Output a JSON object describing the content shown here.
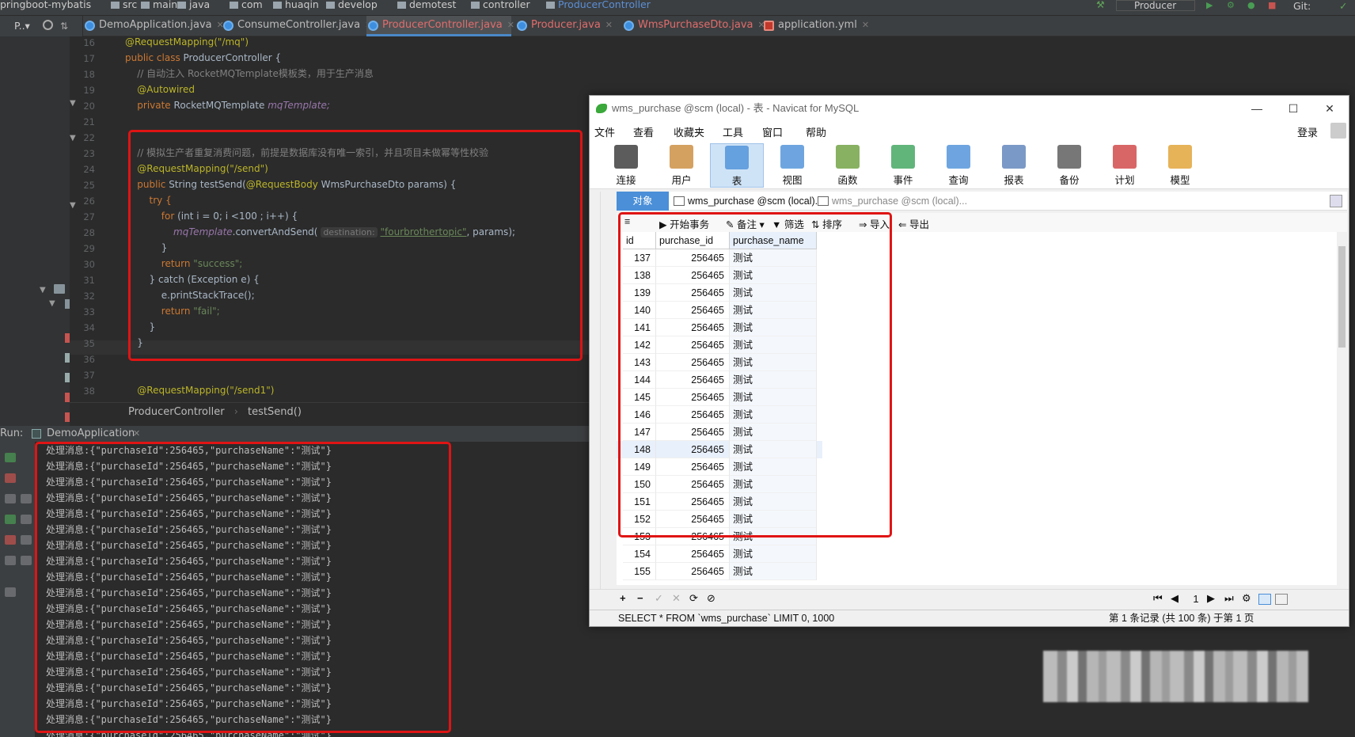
{
  "ide": {
    "breadcrumbs": [
      "pringboot-mybatis",
      "src",
      "main",
      "java",
      "com",
      "huaqin",
      "develop",
      "demotest",
      "controller",
      "ProducerController"
    ],
    "run_config": "Producer",
    "vcs": "Git:",
    "project_label": "P..▾",
    "tabs": [
      {
        "label": "DemoApplication.java"
      },
      {
        "label": "ConsumeController.java"
      },
      {
        "label": "ProducerController.java"
      },
      {
        "label": "Producer.java"
      },
      {
        "label": "WmsPurchaseDto.java"
      },
      {
        "label": "application.yml"
      }
    ],
    "line_numbers": [
      "16",
      "17",
      "18",
      "19",
      "20",
      "21",
      "22",
      "23",
      "24",
      "25",
      "26",
      "27",
      "28",
      "29",
      "30",
      "31",
      "32",
      "33",
      "34",
      "35",
      "36",
      "37",
      "38"
    ],
    "code": {
      "l16": "@RequestMapping(\"/mq\")",
      "l17_kw": "public class ",
      "l17_name": "ProducerController {",
      "l18": "// 自动注入 RocketMQTemplate模板类，用于生产消息",
      "l19": "@Autowired",
      "l20_kw": "private ",
      "l20_type": "RocketMQTemplate ",
      "l20_field": "mqTemplate;",
      "l23": "// 模拟生产者重复消费问题，前提是数据库没有唯一索引，并且项目未做幂等性校验",
      "l24": "@RequestMapping(\"/send\")",
      "l25_kw": "public ",
      "l25_rest": "String testSend(",
      "l25_ann": "@RequestBody ",
      "l25_tail": "WmsPurchaseDto params) {",
      "l26": "try {",
      "l27_kw": "for ",
      "l27_rest": "(int i = 0; i <100 ; i++) {",
      "l28_field": "mqTemplate",
      "l28_call": ".convertAndSend(",
      "l28_hint": "destination:",
      "l28_str": "\"fourbrothertopic\"",
      "l28_tail": ", params);",
      "l29": "}",
      "l30_kw": "return ",
      "l30_str": "\"success\";",
      "l31": "} catch (Exception e) {",
      "l32": "e.printStackTrace();",
      "l33_kw": "return ",
      "l33_str": "\"fail\";",
      "l34": "}",
      "l35": "}",
      "l38": "@RequestMapping(\"/send1\")"
    },
    "editor_breadcrumb": [
      "ProducerController",
      "testSend()"
    ],
    "run_label": "Run:",
    "run_tab": "DemoApplication",
    "console_line": "处理消息:{\"purchaseId\":256465,\"purchaseName\":\"测试\"}",
    "console_line_count": 19,
    "console_last_partial": "处理消息:{\"purchaseId\":256465,\"purchaseName\":\"测试\"}"
  },
  "navicat": {
    "title": "wms_purchase @scm (local) - 表 - Navicat for MySQL",
    "menu": [
      "文件",
      "查看",
      "收藏夹",
      "工具",
      "窗口",
      "帮助"
    ],
    "login": "登录",
    "toolbar": [
      {
        "label": "连接",
        "icon": "plug-icon"
      },
      {
        "label": "用户",
        "icon": "user-icon"
      },
      {
        "label": "表",
        "icon": "table-icon"
      },
      {
        "label": "视图",
        "icon": "view-icon"
      },
      {
        "label": "函数",
        "icon": "function-icon"
      },
      {
        "label": "事件",
        "icon": "event-icon"
      },
      {
        "label": "查询",
        "icon": "query-icon"
      },
      {
        "label": "报表",
        "icon": "report-icon"
      },
      {
        "label": "备份",
        "icon": "backup-icon"
      },
      {
        "label": "计划",
        "icon": "schedule-icon"
      },
      {
        "label": "模型",
        "icon": "model-icon"
      }
    ],
    "object_tabs": [
      "对象",
      "wms_purchase @scm (local)...",
      "wms_purchase @scm (local)..."
    ],
    "grid_toolbar": [
      "开始事务",
      "备注",
      "筛选",
      "排序",
      "导入",
      "导出"
    ],
    "columns": [
      "id",
      "purchase_id",
      "purchase_name"
    ],
    "rows": [
      [
        "137",
        "256465",
        "测试"
      ],
      [
        "138",
        "256465",
        "测试"
      ],
      [
        "139",
        "256465",
        "测试"
      ],
      [
        "140",
        "256465",
        "测试"
      ],
      [
        "141",
        "256465",
        "测试"
      ],
      [
        "142",
        "256465",
        "测试"
      ],
      [
        "143",
        "256465",
        "测试"
      ],
      [
        "144",
        "256465",
        "测试"
      ],
      [
        "145",
        "256465",
        "测试"
      ],
      [
        "146",
        "256465",
        "测试"
      ],
      [
        "147",
        "256465",
        "测试"
      ],
      [
        "148",
        "256465",
        "测试"
      ],
      [
        "149",
        "256465",
        "测试"
      ],
      [
        "150",
        "256465",
        "测试"
      ],
      [
        "151",
        "256465",
        "测试"
      ],
      [
        "152",
        "256465",
        "测试"
      ],
      [
        "153",
        "256465",
        "测试"
      ],
      [
        "154",
        "256465",
        "测试"
      ],
      [
        "155",
        "256465",
        "测试"
      ]
    ],
    "page_number": "1",
    "sql": "SELECT * FROM `wms_purchase` LIMIT 0, 1000",
    "record_status": "第 1 条记录 (共 100 条) 于第 1 页",
    "highlight_color": "#e01414"
  }
}
